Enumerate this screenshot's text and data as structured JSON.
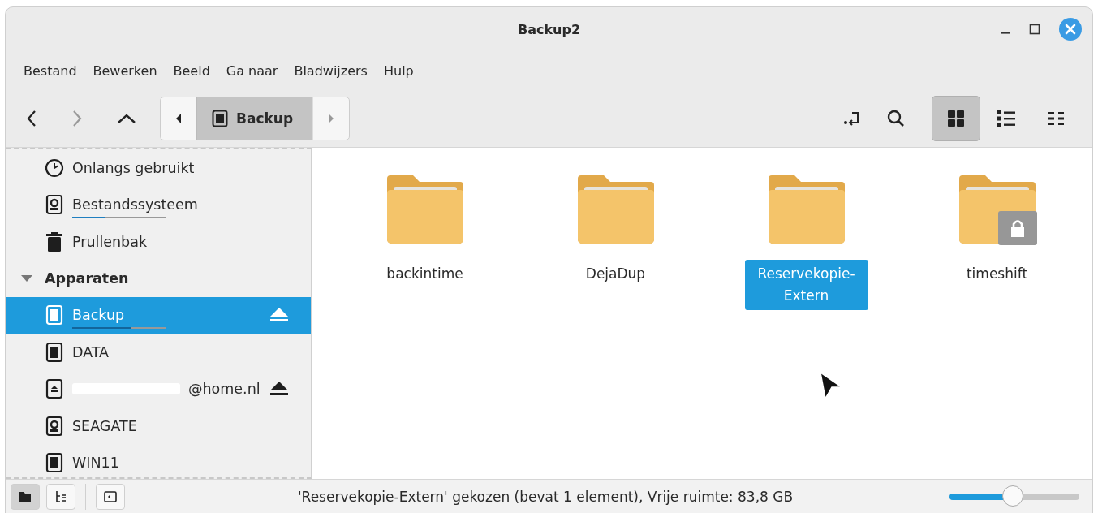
{
  "window": {
    "title": "Backup2"
  },
  "menu": [
    "Bestand",
    "Bewerken",
    "Beeld",
    "Ga naar",
    "Bladwijzers",
    "Hulp"
  ],
  "toolbar": {
    "back_disabled": false,
    "forward_disabled": true,
    "path": [
      {
        "label": "Backup",
        "selected": true
      }
    ],
    "views": [
      {
        "selected": true
      },
      {
        "selected": false
      },
      {
        "selected": false
      }
    ]
  },
  "sidebar": {
    "items": [
      {
        "kind": "clock",
        "label": "Onlangs gebruikt",
        "selected": false,
        "ejectable": false
      },
      {
        "kind": "disk",
        "label": "Bestandssysteem",
        "selected": false,
        "ejectable": false,
        "level": 0.35
      },
      {
        "kind": "trash",
        "label": "Prullenbak",
        "selected": false,
        "ejectable": false
      }
    ],
    "section": {
      "label": "Apparaten",
      "expanded": true,
      "items": [
        {
          "kind": "chip",
          "label": "Backup",
          "selected": true,
          "ejectable": true,
          "level": 0.63
        },
        {
          "kind": "chip",
          "label": "DATA",
          "selected": false,
          "ejectable": false
        },
        {
          "kind": "remote",
          "label": "@home.nl",
          "redacted": true,
          "selected": false,
          "ejectable": true
        },
        {
          "kind": "disk",
          "label": "SEAGATE",
          "selected": false,
          "ejectable": false
        },
        {
          "kind": "chip",
          "label": "WIN11",
          "selected": false,
          "ejectable": false
        }
      ]
    }
  },
  "files": [
    {
      "name": "backintime",
      "selected": false,
      "locked": false
    },
    {
      "name": "DejaDup",
      "selected": false,
      "locked": false
    },
    {
      "name": "Reservekopie-Extern",
      "selected": true,
      "locked": false
    },
    {
      "name": "timeshift",
      "selected": false,
      "locked": true
    }
  ],
  "status_bar": {
    "text": "'Reservekopie-Extern' gekozen (bevat 1 element), Vrije ruimte: 83,8 GB",
    "zoom": {
      "level": 0.49
    },
    "pane_buttons": [
      {
        "selected": true
      },
      {
        "selected": false
      }
    ]
  }
}
